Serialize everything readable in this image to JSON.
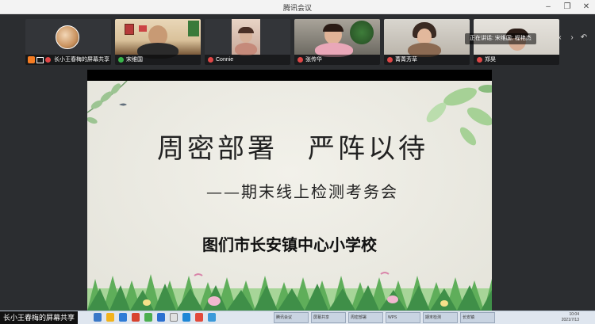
{
  "window": {
    "title": "腾讯会议",
    "controls": {
      "minimize": "–",
      "restore": "❐",
      "close": "✕"
    }
  },
  "participants": [
    {
      "name": "长小王春梅的屏幕共享",
      "mic": "muted",
      "type": "screen-share"
    },
    {
      "name": "宋维国",
      "mic": "on"
    },
    {
      "name": "Connie",
      "mic": "muted"
    },
    {
      "name": "张传华",
      "mic": "muted"
    },
    {
      "name": "菁菁芳草",
      "mic": "muted"
    },
    {
      "name": "郑昊",
      "mic": "muted"
    }
  ],
  "speaking": "正在讲话: 宋维国; 程艳杰",
  "strip_controls": [
    "‹",
    "›",
    "↶"
  ],
  "slide": {
    "title": "周密部署　严阵以待",
    "subtitle": "——期末线上检测考务会",
    "school": "图们市长安镇中心小学校"
  },
  "share_bar": {
    "label": "长小王春梅的屏幕共享"
  },
  "taskbar": {
    "apps": [
      "腾讯会议",
      "屏幕共享",
      "周密部署",
      "WPS",
      "期末检测",
      "长安镇"
    ],
    "clock": "10:04",
    "date": "2021/7/13"
  },
  "colors": {
    "accent_orange": "#f57c22",
    "mic_muted": "#e04646",
    "mic_on": "#39b54a"
  }
}
